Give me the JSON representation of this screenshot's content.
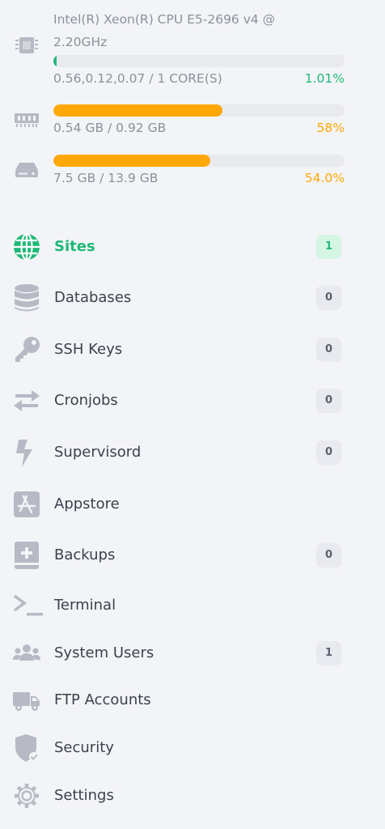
{
  "stats": {
    "cpu": {
      "name": "Intel(R) Xeon(R) CPU E5-2696 v4 @ 2.20GHz",
      "load": "0.56,0.12,0.07 / 1 CORE(S)",
      "percent_label": "1.01%",
      "percent": 1.01,
      "color": "#1fb978"
    },
    "memory": {
      "usage": "0.54 GB / 0.92 GB",
      "percent_label": "58%",
      "percent": 58,
      "color": "#fea808"
    },
    "disk": {
      "usage": "7.5 GB / 13.9 GB",
      "percent_label": "54.0%",
      "percent": 54.0,
      "color": "#fea808"
    }
  },
  "nav": {
    "sites": {
      "label": "Sites",
      "count": "1",
      "icon": "globe-icon"
    },
    "databases": {
      "label": "Databases",
      "count": "0",
      "icon": "database-icon"
    },
    "ssh_keys": {
      "label": "SSH Keys",
      "count": "0",
      "icon": "key-icon"
    },
    "cronjobs": {
      "label": "Cronjobs",
      "count": "0",
      "icon": "swap-arrows-icon"
    },
    "supervisord": {
      "label": "Supervisord",
      "count": "0",
      "icon": "lightning-icon"
    },
    "appstore": {
      "label": "Appstore",
      "icon": "appstore-icon"
    },
    "backups": {
      "label": "Backups",
      "count": "0",
      "icon": "backup-book-icon"
    },
    "terminal": {
      "label": "Terminal",
      "icon": "terminal-icon"
    },
    "system_users": {
      "label": "System Users",
      "count": "1",
      "icon": "users-icon"
    },
    "ftp_accounts": {
      "label": "FTP Accounts",
      "icon": "truck-icon"
    },
    "security": {
      "label": "Security",
      "icon": "shield-icon"
    },
    "settings": {
      "label": "Settings",
      "icon": "gear-icon"
    }
  },
  "colors": {
    "accent_green": "#1fb978",
    "accent_orange": "#fea808",
    "icon_gray": "#b7bac4",
    "background": "#f3f4f7"
  }
}
